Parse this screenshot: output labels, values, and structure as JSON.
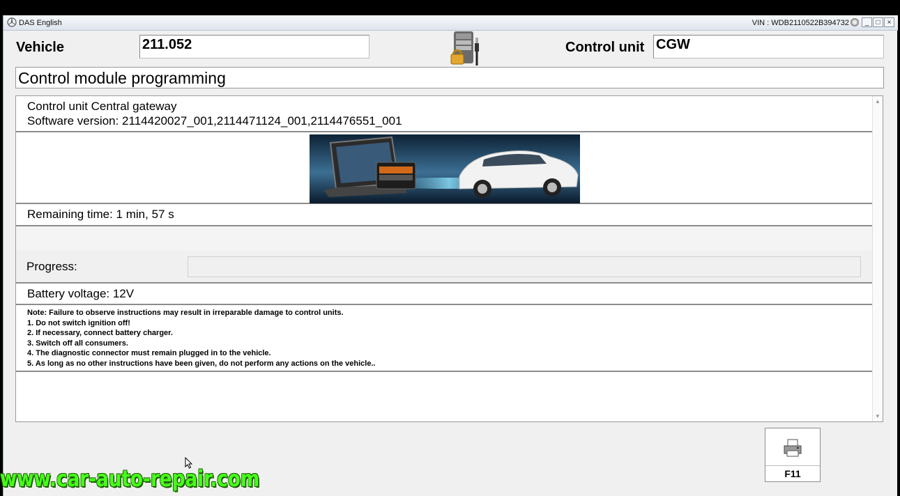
{
  "window": {
    "app_title": "DAS English",
    "vin": "VIN : WDB2110522B394732",
    "minimize": "_",
    "restore": "□",
    "close": "×"
  },
  "header": {
    "vehicle_label": "Vehicle",
    "vehicle_value": "211.052",
    "control_unit_label": "Control unit",
    "control_unit_value": "CGW",
    "icon": "locked-ecu-connector-icon"
  },
  "page_title": "Control module programming",
  "info": {
    "unit_line": "Control unit Central gateway",
    "software_line": "Software version: 2114420027_001,2114471124_001,2114476551_001"
  },
  "banner": {
    "icon": "diagnostic-tablet-and-car-banner"
  },
  "remaining_time": "Remaining time: 1 min, 57 s",
  "progress": {
    "label": "Progress:",
    "fraction": 0.0
  },
  "battery_voltage": "Battery voltage: 12V",
  "notes": [
    "Note:  Failure to observe instructions may result in irreparable damage to control units.",
    "1. Do not switch ignition off!",
    "2. If necessary, connect battery charger.",
    "3. Switch off all consumers.",
    "4. The diagnostic connector must remain plugged in to the vehicle.",
    "5. As long as no other instructions have been given, do not perform any actions on the vehicle.."
  ],
  "f11_button": {
    "label": "F11",
    "icon": "printer-icon"
  },
  "watermark": "www.car-auto-repair.com"
}
